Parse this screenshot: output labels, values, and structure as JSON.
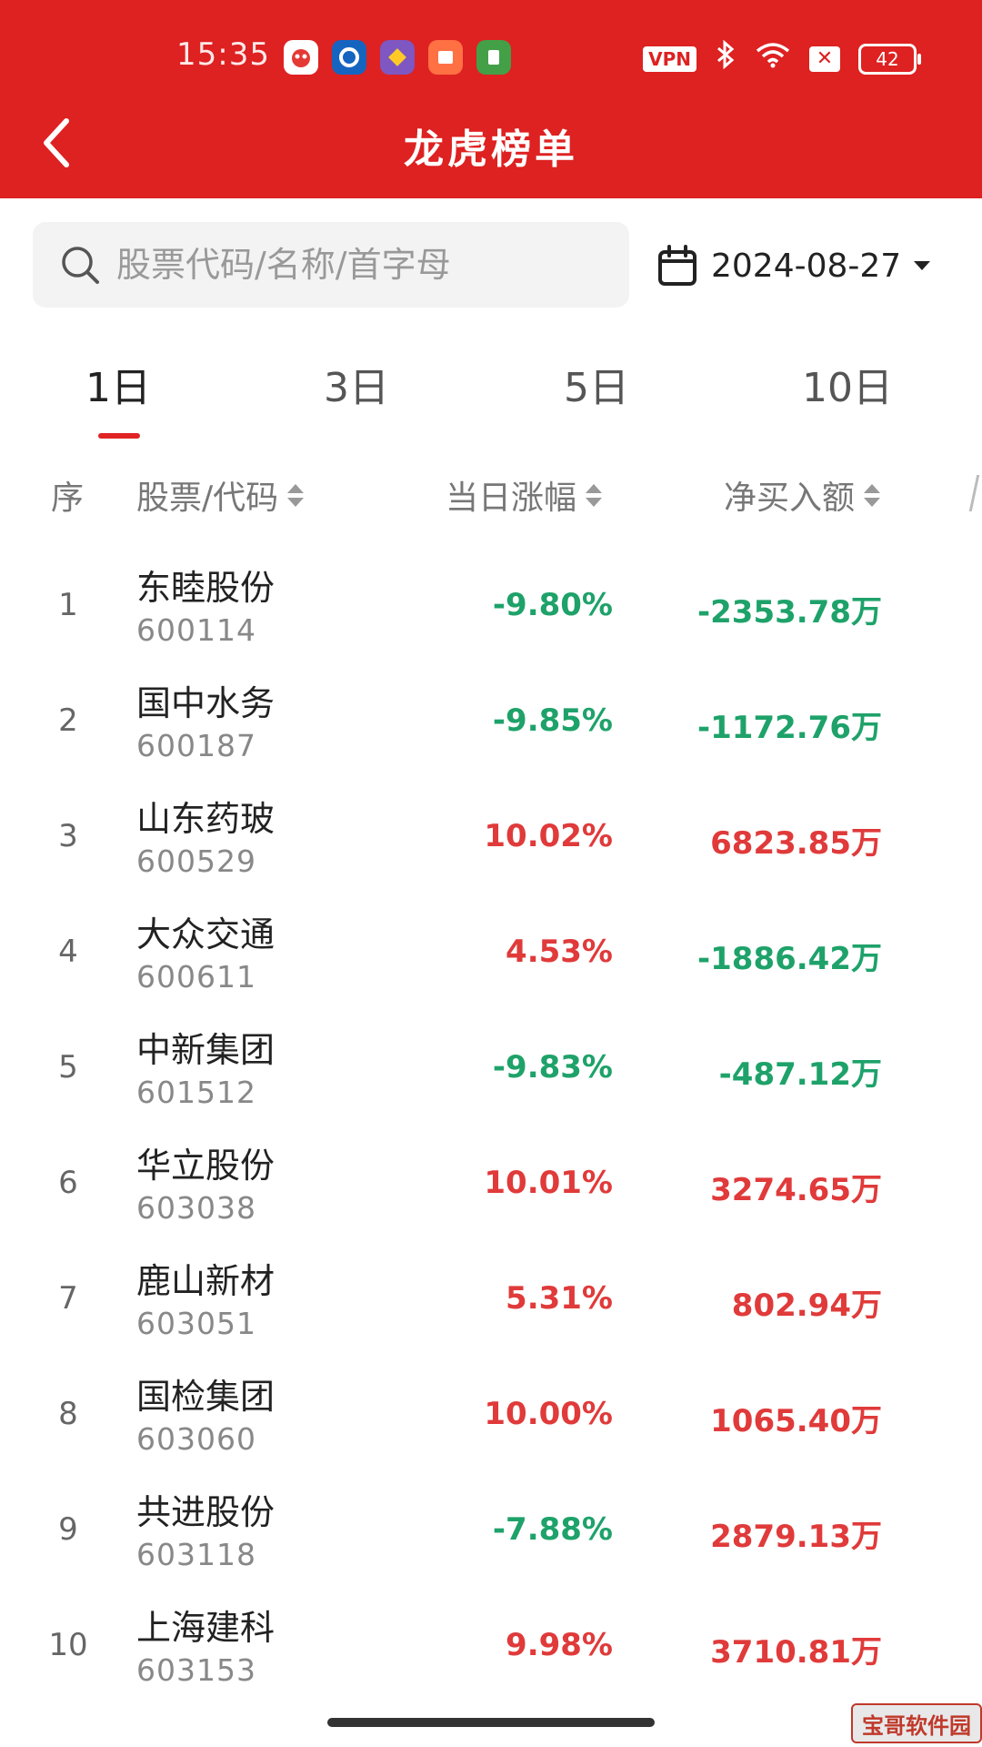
{
  "status_bar": {
    "time": "15:35",
    "vpn": "VPN",
    "battery": "42",
    "colors": {
      "background": "#de2121"
    }
  },
  "header": {
    "title": "龙虎榜单",
    "back_icon": "chevron-left-icon"
  },
  "search": {
    "placeholder": "股票代码/名称/首字母",
    "value": ""
  },
  "date_filter": {
    "date": "2024-08-27",
    "icon": "calendar-icon"
  },
  "tabs": [
    {
      "label": "1日",
      "active": true
    },
    {
      "label": "3日",
      "active": false
    },
    {
      "label": "5日",
      "active": false
    },
    {
      "label": "10日",
      "active": false
    }
  ],
  "columns": {
    "rank": "序",
    "stock": "股票/代码",
    "change": "当日涨幅",
    "net_buy": "净买入额"
  },
  "rows": [
    {
      "rank": "1",
      "name": "东睦股份",
      "code": "600114",
      "change": "-9.80%",
      "net_buy": "-2353.78万"
    },
    {
      "rank": "2",
      "name": "国中水务",
      "code": "600187",
      "change": "-9.85%",
      "net_buy": "-1172.76万"
    },
    {
      "rank": "3",
      "name": "山东药玻",
      "code": "600529",
      "change": "10.02%",
      "net_buy": "6823.85万"
    },
    {
      "rank": "4",
      "name": "大众交通",
      "code": "600611",
      "change": "4.53%",
      "net_buy": "-1886.42万"
    },
    {
      "rank": "5",
      "name": "中新集团",
      "code": "601512",
      "change": "-9.83%",
      "net_buy": "-487.12万"
    },
    {
      "rank": "6",
      "name": "华立股份",
      "code": "603038",
      "change": "10.01%",
      "net_buy": "3274.65万"
    },
    {
      "rank": "7",
      "name": "鹿山新材",
      "code": "603051",
      "change": "5.31%",
      "net_buy": "802.94万"
    },
    {
      "rank": "8",
      "name": "国检集团",
      "code": "603060",
      "change": "10.00%",
      "net_buy": "1065.40万"
    },
    {
      "rank": "9",
      "name": "共进股份",
      "code": "603118",
      "change": "-7.88%",
      "net_buy": "2879.13万"
    },
    {
      "rank": "10",
      "name": "上海建科",
      "code": "603153",
      "change": "9.98%",
      "net_buy": "3710.81万"
    }
  ],
  "colors": {
    "up": "#e03a3a",
    "down": "#1ea26a",
    "accent": "#de2121"
  },
  "watermark": "宝哥软件园"
}
